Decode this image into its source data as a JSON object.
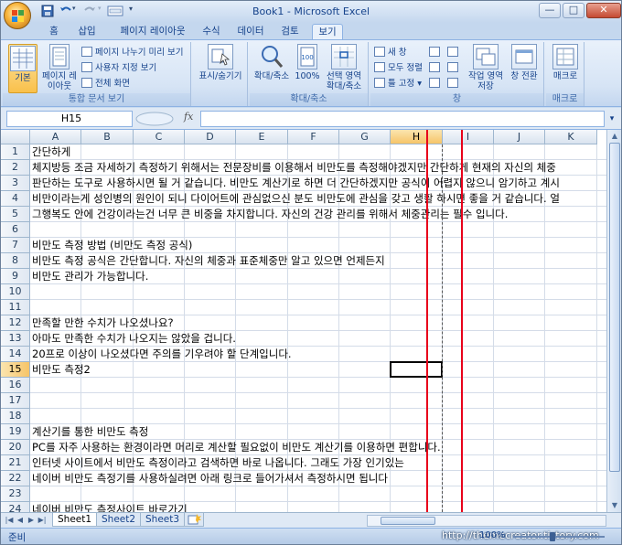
{
  "window": {
    "title": "Book1 - Microsoft Excel",
    "controls": {
      "minimize": "—",
      "maximize": "□",
      "close": "✕"
    }
  },
  "tabs": [
    "홈",
    "삽입",
    "페이지 레이아웃",
    "수식",
    "데이터",
    "검토",
    "보기"
  ],
  "active_tab": "보기",
  "ribbon": {
    "group_views": {
      "label": "통합 문서 보기",
      "normal": "기본",
      "page_layout": "페이지 레이아웃",
      "page_break_preview": "페이지 나누기 미리 보기",
      "custom_views": "사용자 지정 보기",
      "full_screen": "전체 화면"
    },
    "group_show": {
      "show_hide": "표시/숨기기"
    },
    "group_zoom": {
      "label": "확대/축소",
      "zoom": "확대/축소",
      "zoom_100": "100%",
      "zoom_selection": "선택 영역 확대/축소"
    },
    "group_window": {
      "label": "창",
      "new_window": "새 창",
      "arrange_all": "모두 정렬",
      "freeze_panes": "틀 고정",
      "save_workspace": "작업 영역 저장",
      "switch_windows": "창 전환"
    },
    "group_macros": {
      "label": "매크로",
      "macros": "매크로"
    }
  },
  "formula_bar": {
    "name_box": "H15",
    "fx": "fx",
    "formula": ""
  },
  "columns": [
    "A",
    "B",
    "C",
    "D",
    "E",
    "F",
    "G",
    "H",
    "I",
    "J",
    "K"
  ],
  "selected_column": "H",
  "selected_row": "15",
  "rows": [
    {
      "n": "1",
      "text": "간단하게"
    },
    {
      "n": "2",
      "text": "체지방등 조금 자세하기 측정하기 위해서는 전문장비를 이용해서 비만도를 측정해야겠지만 간단하게 현재의 자신의 체중"
    },
    {
      "n": "3",
      "text": "판단하는 도구로 사용하시면 될 거 같습니다. 비만도 계산기로 하면 더 간단하겠지만 공식이 어렵지 않으니 암기하고 계시"
    },
    {
      "n": "4",
      "text": "비만이라는게 성인병의 원인이 되니 다이어트에 관심없으신 분도 비만도에 관심을 갖고 생활 하시면 좋을 거 같습니다. 얼"
    },
    {
      "n": "5",
      "text": "그행복도 안에 건강이라는건 너무 큰 비중을 차지합니다. 자신의 건강 관리를 위해서 체중관리는 필수 입니다."
    },
    {
      "n": "6",
      "text": ""
    },
    {
      "n": "7",
      "text": " 비만도 측정 방법 (비만도 측정 공식)"
    },
    {
      "n": "8",
      "text": "비만도 측정 공식은 간단합니다. 자신의 체중과 표준체중만 알고 있으면 언제든지"
    },
    {
      "n": "9",
      "text": "비만도 관리가 가능합니다."
    },
    {
      "n": "10",
      "text": ""
    },
    {
      "n": "11",
      "text": ""
    },
    {
      "n": "12",
      "text": "만족할 만한 수치가 나오셨나요?"
    },
    {
      "n": "13",
      "text": "아마도 만족한 수치가 나오지는 않았을 겁니다."
    },
    {
      "n": "14",
      "text": "20프로 이상이 나오셨다면 주의를 기우려야 할 단계입니다."
    },
    {
      "n": "15",
      "text": "비만도 측정2"
    },
    {
      "n": "16",
      "text": ""
    },
    {
      "n": "17",
      "text": ""
    },
    {
      "n": "18",
      "text": ""
    },
    {
      "n": "19",
      "text": " 계산기를 통한 비만도 측정"
    },
    {
      "n": "20",
      "text": "PC를 자주 사용하는 환경이라면 머리로 계산할 필요없이 비만도 계산기를 이용하면 편합니다."
    },
    {
      "n": "21",
      "text": "인터넷 사이트에서 비만도 측정이라고 검색하면 바로 나옵니다. 그래도 가장 인기있는"
    },
    {
      "n": "22",
      "text": "네이버 비만도 측정기를 사용하실려면 아래 링크로 들어가셔서 측정하시면 됩니다"
    },
    {
      "n": "23",
      "text": ""
    },
    {
      "n": "24",
      "text": "네이버 비만도 측정사이트 바로가기"
    }
  ],
  "sheets": [
    "Sheet1",
    "Sheet2",
    "Sheet3"
  ],
  "active_sheet": "Sheet1",
  "status": {
    "ready": "준비",
    "watermark": "http://themecreator.tistory.com",
    "zoom": "100%"
  },
  "colors": {
    "highlight_box": "#e8001a",
    "ribbon": "#d6e4f5",
    "selected_header": "#f6c468"
  }
}
